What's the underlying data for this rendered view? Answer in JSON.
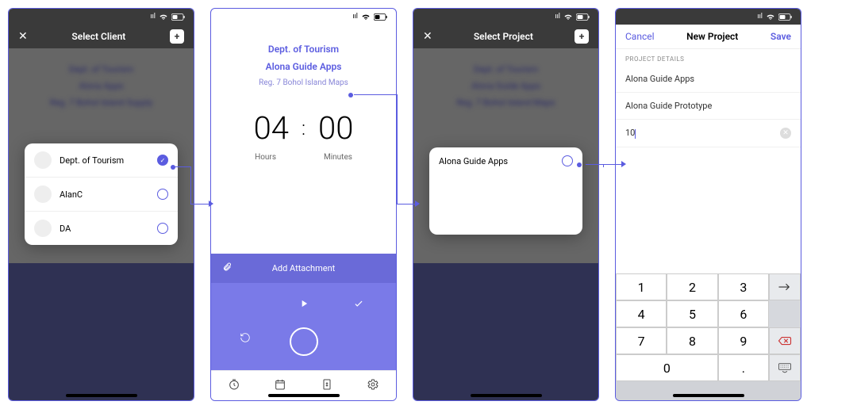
{
  "screen1": {
    "title": "Select Client",
    "blur_lines": [
      "Dept. of Tourism",
      "Alona Apps",
      "Reg. 7 Bohol Island Supply"
    ],
    "clients": [
      {
        "name": "Dept. of Tourism",
        "selected": true
      },
      {
        "name": "AlanC",
        "selected": false
      },
      {
        "name": "DA",
        "selected": false
      }
    ]
  },
  "screen2": {
    "brand": "Dept. of Tourism",
    "project": "Alona Guide Apps",
    "subproject": "Reg. 7 Bohol Island Maps",
    "hours": "04",
    "minutes": "00",
    "hours_label": "Hours",
    "minutes_label": "Minutes",
    "attach_label": "Add Attachment"
  },
  "screen3": {
    "title": "Select Project",
    "blur_lines": [
      "Dept. of Tourism",
      "Alona Guide Apps",
      "Reg. 7 Bohol Island Maps"
    ],
    "projects": [
      {
        "name": "Alona Guide Apps",
        "selected": false
      }
    ]
  },
  "screen4": {
    "cancel": "Cancel",
    "title": "New Project",
    "save": "Save",
    "section": "PROJECT DETAILS",
    "line1": "Alona Guide Apps",
    "line2": "Alona Guide Prototype",
    "input_value": "10",
    "keys": [
      "1",
      "2",
      "3",
      "4",
      "5",
      "6",
      "7",
      "8",
      "9",
      "0",
      "."
    ]
  }
}
